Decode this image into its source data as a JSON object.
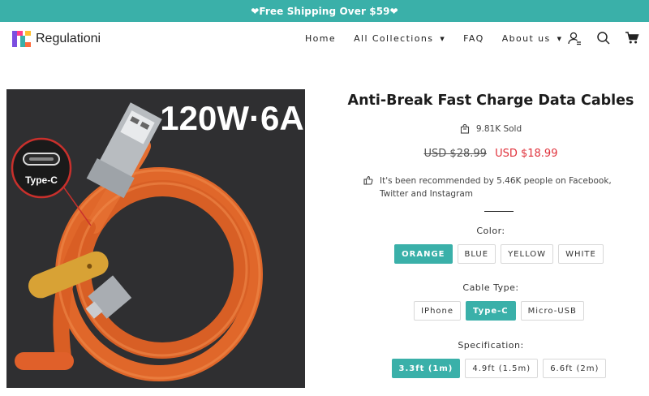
{
  "announcement": "❤Free Shipping Over $59❤",
  "brand": {
    "name": "Regulationi"
  },
  "nav": [
    {
      "label": "Home",
      "dropdown": false
    },
    {
      "label": "All Collections",
      "dropdown": true
    },
    {
      "label": "FAQ",
      "dropdown": false
    },
    {
      "label": "About us",
      "dropdown": true
    }
  ],
  "header_icons": [
    "account-icon",
    "search-icon",
    "cart-icon"
  ],
  "image": {
    "headline": "120W·6A",
    "badge": "Type-C"
  },
  "product": {
    "title": "Anti-Break Fast Charge Data Cables",
    "sold": "9.81K Sold",
    "old_price": "USD $28.99",
    "price": "USD $18.99",
    "recommend": "It's been recommended by 5.46K people on Facebook, Twitter and Instagram"
  },
  "options": {
    "color": {
      "label": "Color:",
      "values": [
        "ORANGE",
        "BLUE",
        "YELLOW",
        "WHITE"
      ],
      "selected": "ORANGE"
    },
    "cable_type": {
      "label": "Cable Type:",
      "values": [
        "IPhone",
        "Type-C",
        "Micro-USB"
      ],
      "selected": "Type-C"
    },
    "specification": {
      "label": "Specification:",
      "values": [
        "3.3ft (1m)",
        "4.9ft (1.5m)",
        "6.6ft (2m)"
      ],
      "selected": "3.3ft (1m)"
    }
  },
  "colors": {
    "accent": "#3ab0a9",
    "sale": "#e0313b",
    "cable": "#e0672a"
  }
}
